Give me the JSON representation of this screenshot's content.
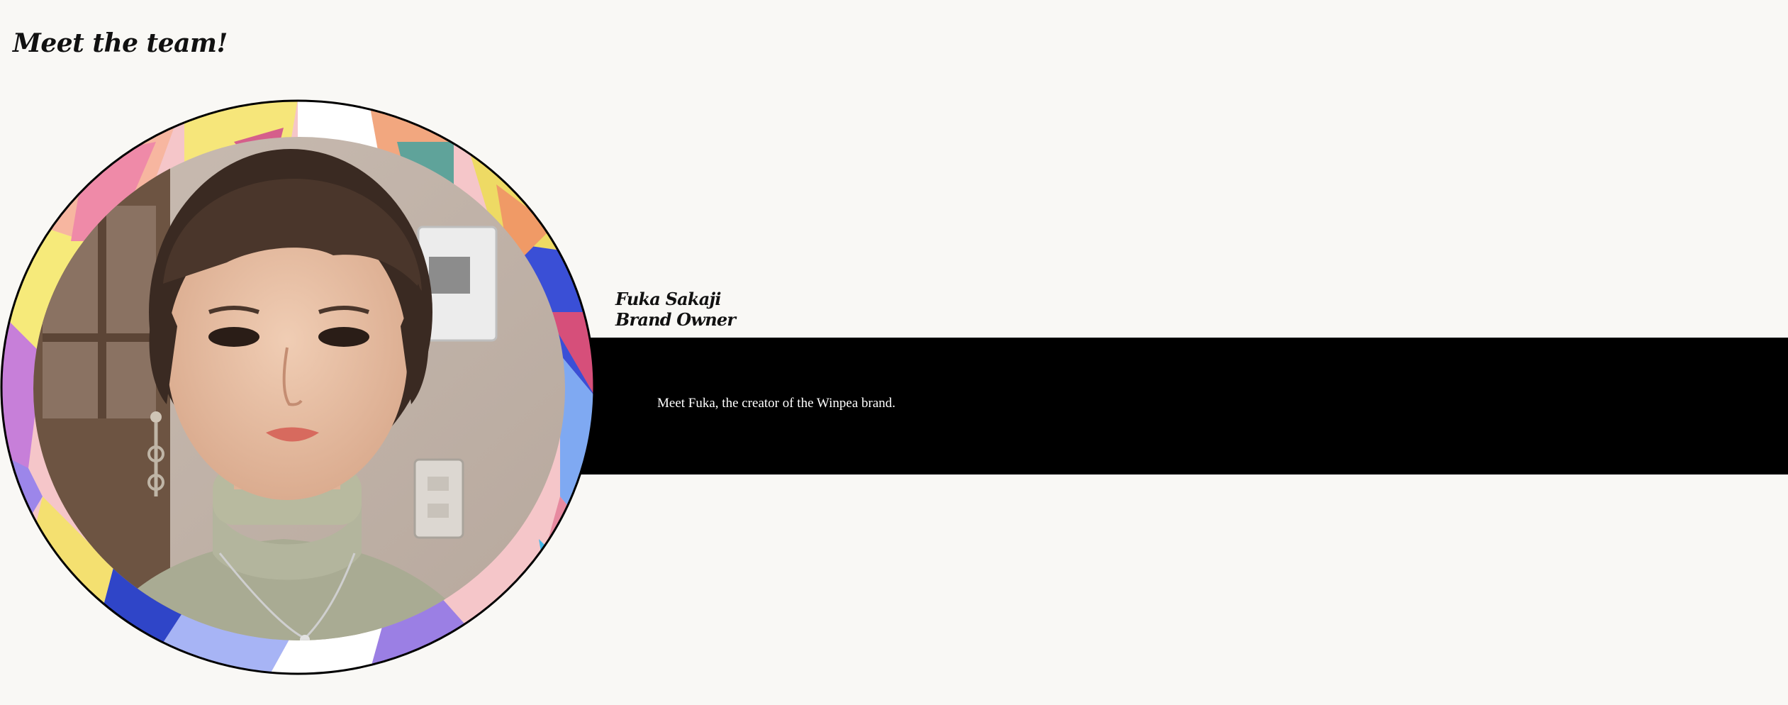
{
  "heading": "Meet the team!",
  "member": {
    "name": "Fuka Sakaji",
    "role": "Brand Owner",
    "bio": "Meet Fuka, the creator of the Winpea brand."
  },
  "colors": {
    "page_background": "#f9f8f5",
    "band": "#000000",
    "bio_text": "#ffffff",
    "heading_text": "#111111"
  }
}
